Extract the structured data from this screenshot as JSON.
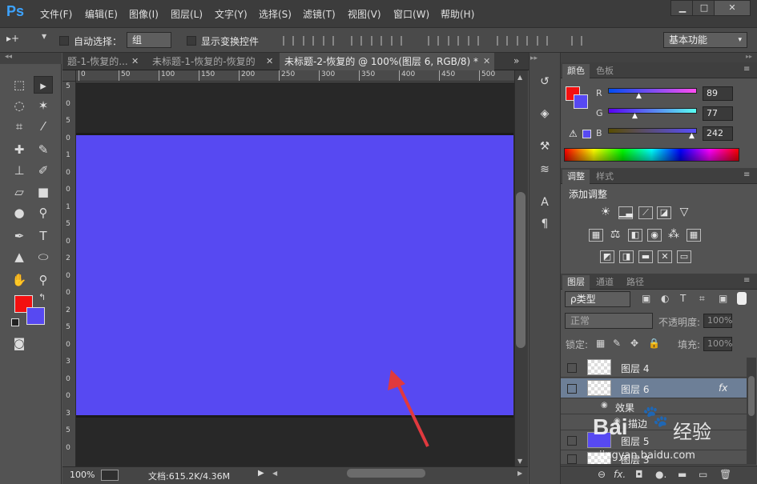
{
  "menubar": {
    "logo": "Ps",
    "items": [
      "文件(F)",
      "编辑(E)",
      "图像(I)",
      "图层(L)",
      "文字(Y)",
      "选择(S)",
      "滤镜(T)",
      "视图(V)",
      "窗口(W)",
      "帮助(H)"
    ],
    "window_buttons": [
      "▁",
      "□",
      "✕"
    ]
  },
  "optionsbar": {
    "tool_glyph": "▸+",
    "auto_select_label": "自动选择：",
    "auto_select_value": "组",
    "show_transform_label": "显示变换控件",
    "workspace": "基本功能"
  },
  "tabs": [
    {
      "label": "题-1-恢复的...",
      "close": "✕"
    },
    {
      "label": "未标题-1-恢复的-恢复的",
      "close": "✕"
    },
    {
      "label": "未标题-2-恢复的 @ 100%(图层 6, RGB/8) *",
      "close": "✕"
    }
  ],
  "tab_overflow": "»",
  "ruler": {
    "h_ticks": [
      "0",
      "50",
      "100",
      "150",
      "200",
      "250",
      "300",
      "350",
      "400",
      "450",
      "500"
    ],
    "v_ticks": [
      "5",
      "0",
      "5",
      "0",
      "1",
      "0",
      "0",
      "1",
      "5",
      "0",
      "2",
      "0",
      "0",
      "2",
      "5",
      "0",
      "3",
      "0",
      "0",
      "3",
      "5",
      "0"
    ]
  },
  "status": {
    "zoom": "100%",
    "doc": "文档:615.2K/4.36M"
  },
  "color_panel": {
    "tabs": [
      "颜色",
      "色板"
    ],
    "r_label": "R",
    "r_value": "89",
    "g_label": "G",
    "g_value": "77",
    "b_label": "B",
    "b_value": "242",
    "fg": "#f31010",
    "bg": "#5749f2"
  },
  "adjust_panel": {
    "tabs": [
      "调整",
      "样式"
    ],
    "title": "添加调整"
  },
  "layers_panel": {
    "tabs": [
      "图层",
      "通道",
      "路径"
    ],
    "filter_label": "ρ类型",
    "blend_mode": "正常",
    "opacity_label": "不透明度:",
    "opacity_value": "100%",
    "lock_label": "锁定:",
    "fill_label": "填充:",
    "fill_value": "100%",
    "layers": [
      {
        "name": "图层 4"
      },
      {
        "name": "图层 6",
        "fx": "fx"
      },
      {
        "name": "效果"
      },
      {
        "name": "描边"
      },
      {
        "name": "图层 5"
      },
      {
        "name": "图层 3"
      }
    ],
    "footer_icons": [
      "⊖",
      "fx.",
      "◘",
      "●.",
      "▬",
      "▭",
      "🗑"
    ]
  },
  "watermark": {
    "brand": "Bai",
    "brand2": "经验",
    "url": "jingyan.baidu.com"
  },
  "colors": {
    "canvas": "#5749f2",
    "arrow": "#e0393e"
  }
}
